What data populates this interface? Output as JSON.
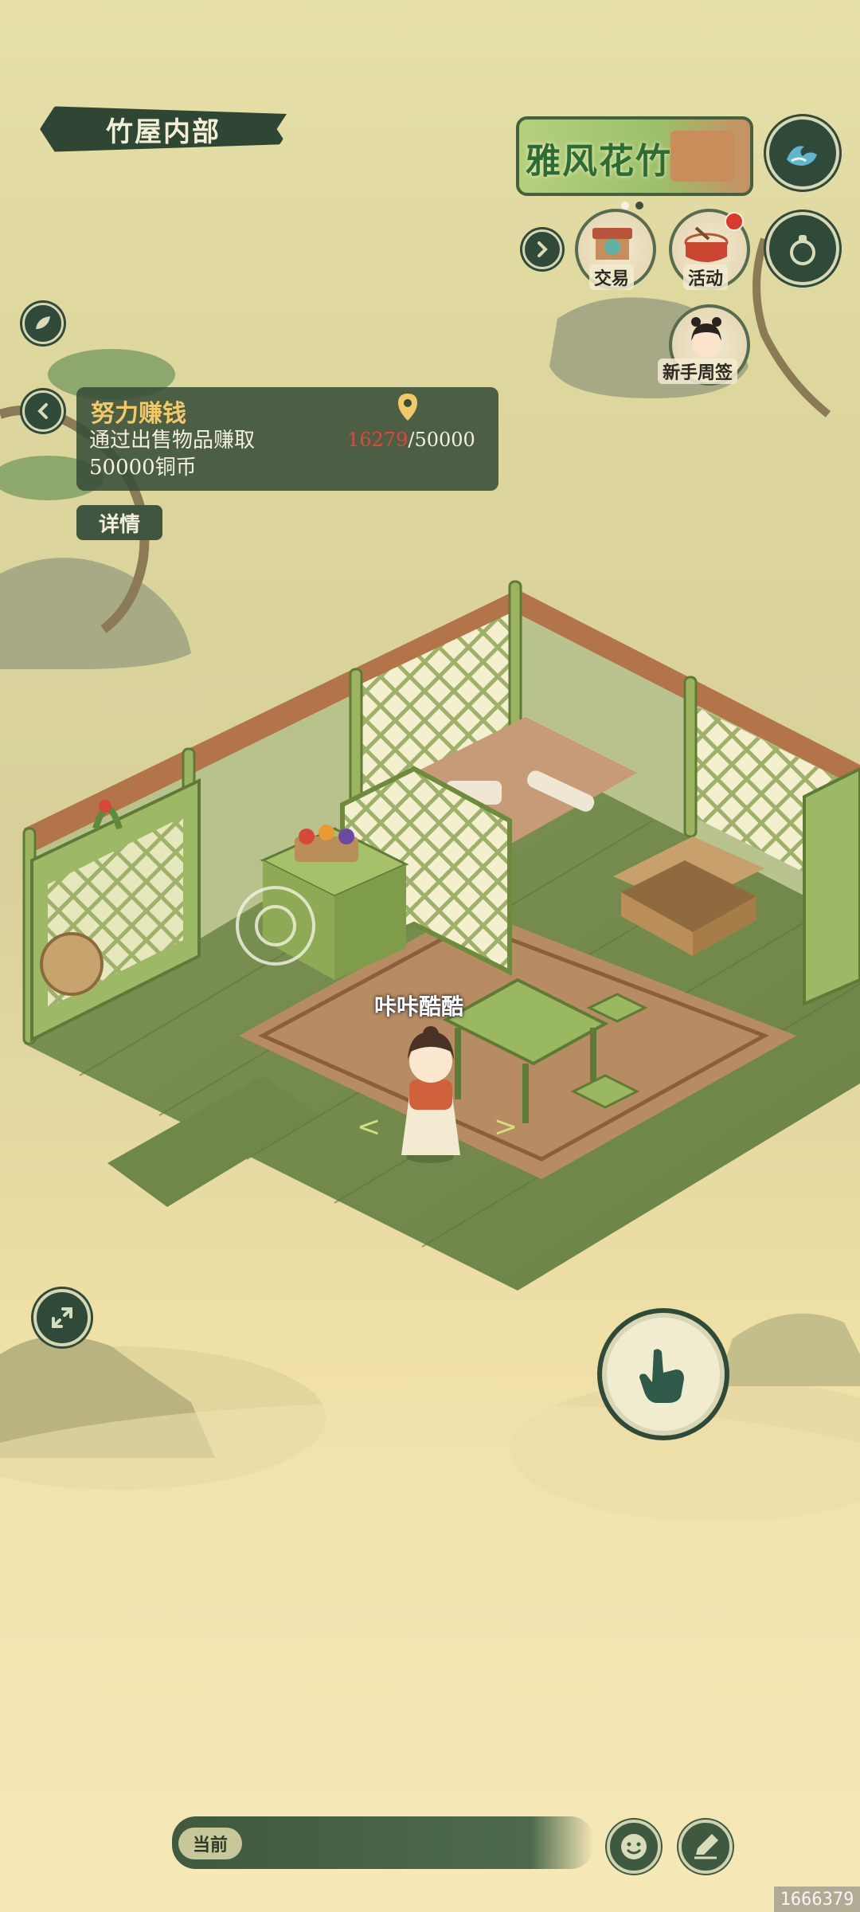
{
  "header": {
    "location_title": "竹屋内部"
  },
  "event_banner": {
    "title": "雅风花竹",
    "page_dots": 2,
    "active_dot": 0
  },
  "menu": {
    "trade_label": "交易",
    "activity_label": "活动",
    "activity_has_notification": true,
    "newbie_week_label": "新手周签"
  },
  "quest": {
    "title": "努力赚钱",
    "description": "通过出售物品赚取50000铜币",
    "progress_current": "16279",
    "progress_separator": "/",
    "progress_total": "50000",
    "details_label": "详情"
  },
  "character": {
    "name": "咔咔酷酷"
  },
  "chat": {
    "channel_label": "当前"
  },
  "watermark": "1666379",
  "colors": {
    "ui_dark_green": "#2f4a38",
    "quest_title": "#f0c96a",
    "progress_current": "#e0463c",
    "notification_dot": "#d93a2b"
  },
  "icons": [
    "leaf-icon",
    "back-chevron-icon",
    "location-pin-icon",
    "expand-icon",
    "wave-icon",
    "gourd-icon",
    "forward-chevron-icon",
    "tap-hand-icon",
    "smiley-icon",
    "edit-icon"
  ]
}
